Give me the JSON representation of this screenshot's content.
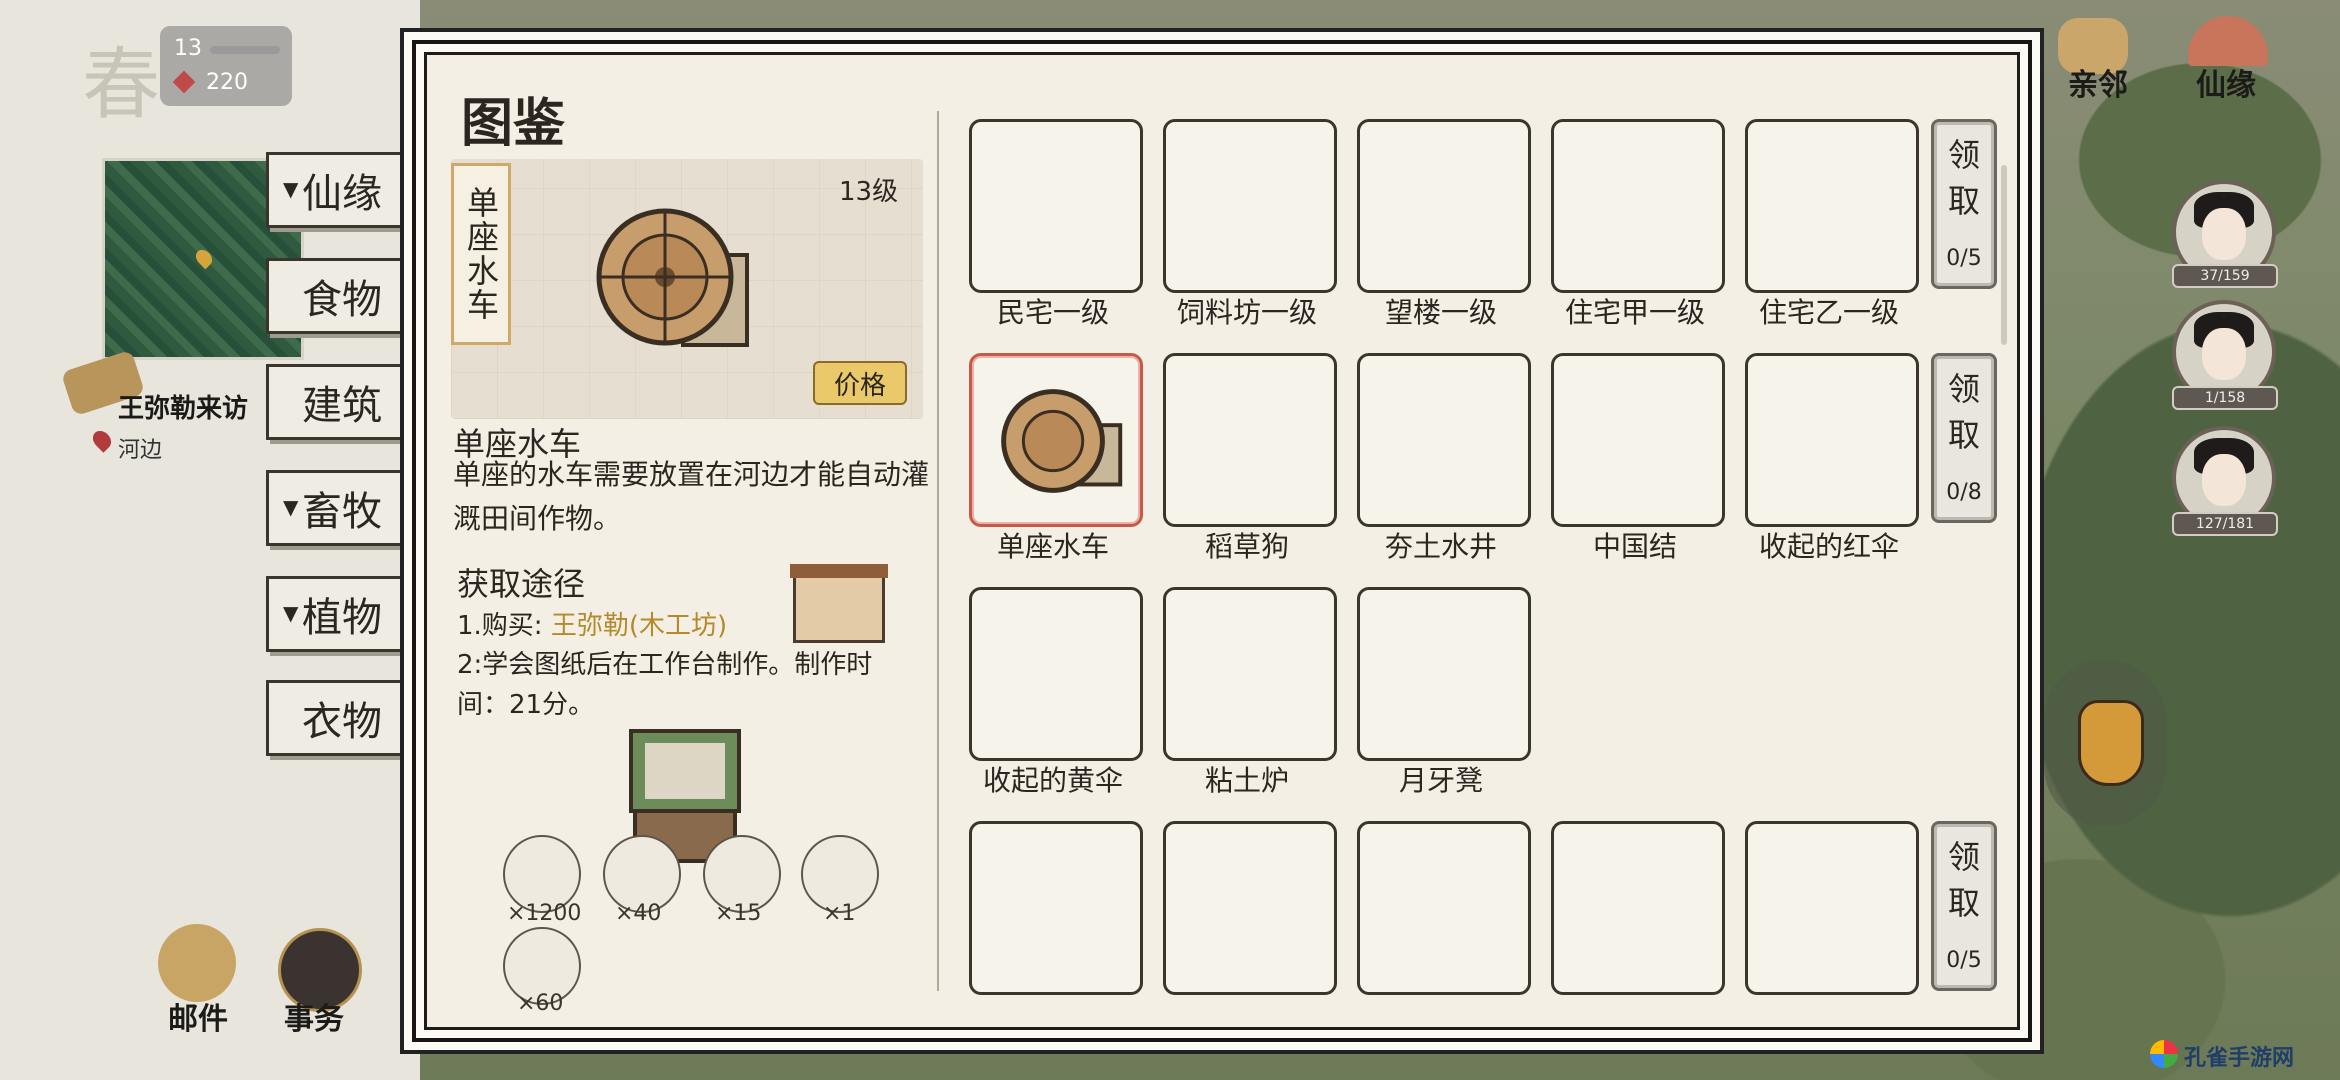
{
  "hud": {
    "season": "春",
    "level": "13",
    "currency": "220"
  },
  "left_categories": [
    {
      "label": "仙缘",
      "arrow": "▼"
    },
    {
      "label": "食物",
      "arrow": ""
    },
    {
      "label": "建筑",
      "arrow": ""
    },
    {
      "label": "畜牧",
      "arrow": "▼"
    },
    {
      "label": "植物",
      "arrow": "▼"
    },
    {
      "label": "衣物",
      "arrow": ""
    }
  ],
  "visitor": {
    "text": "王弥勒来访",
    "location": "河边"
  },
  "bottom_buttons": {
    "mail": "邮件",
    "affairs": "事务"
  },
  "top_right": {
    "neighbors": "亲邻",
    "fate": "仙缘"
  },
  "avatars": [
    {
      "hp": "37/159"
    },
    {
      "hp": "1/158"
    },
    {
      "hp": "127/181"
    }
  ],
  "watermark": "孔雀手游网",
  "panel": {
    "title": "图鉴",
    "selected": {
      "vertical_name": "单座水车",
      "level": "13级",
      "price_button": "价格",
      "name": "单座水车",
      "description": "单座的水车需要放置在河边才能自动灌溉田间作物。",
      "acquire_title": "获取途径",
      "acquire_1_prefix": "1.购买:",
      "acquire_1_shop": "王弥勒(木工坊)",
      "acquire_2": "2:学会图纸后在工作台制作。制作时间：21分。",
      "materials": [
        {
          "icon": "coin-icon",
          "count": "×1200"
        },
        {
          "icon": "stone-icon",
          "count": "×40"
        },
        {
          "icon": "brick-icon",
          "count": "×15"
        },
        {
          "icon": "ingot-icon",
          "count": "×1"
        },
        {
          "icon": "wood-plank-icon",
          "count": "×60"
        }
      ]
    },
    "rows": [
      {
        "items": [
          "民宅一级",
          "饲料坊一级",
          "望楼一级",
          "住宅甲一级",
          "住宅乙一级"
        ],
        "claim": {
          "label": "领取",
          "count": "0/5"
        }
      },
      {
        "items": [
          "单座水车",
          "稻草狗",
          "夯土水井",
          "中国结",
          "收起的红伞"
        ],
        "claim": {
          "label": "领取",
          "count": "0/8"
        }
      },
      {
        "items": [
          "收起的黄伞",
          "粘土炉",
          "月牙凳"
        ],
        "claim": null
      },
      {
        "items": [
          "",
          "",
          "",
          "",
          ""
        ],
        "claim": {
          "label": "领取",
          "count": "0/5"
        }
      }
    ]
  }
}
